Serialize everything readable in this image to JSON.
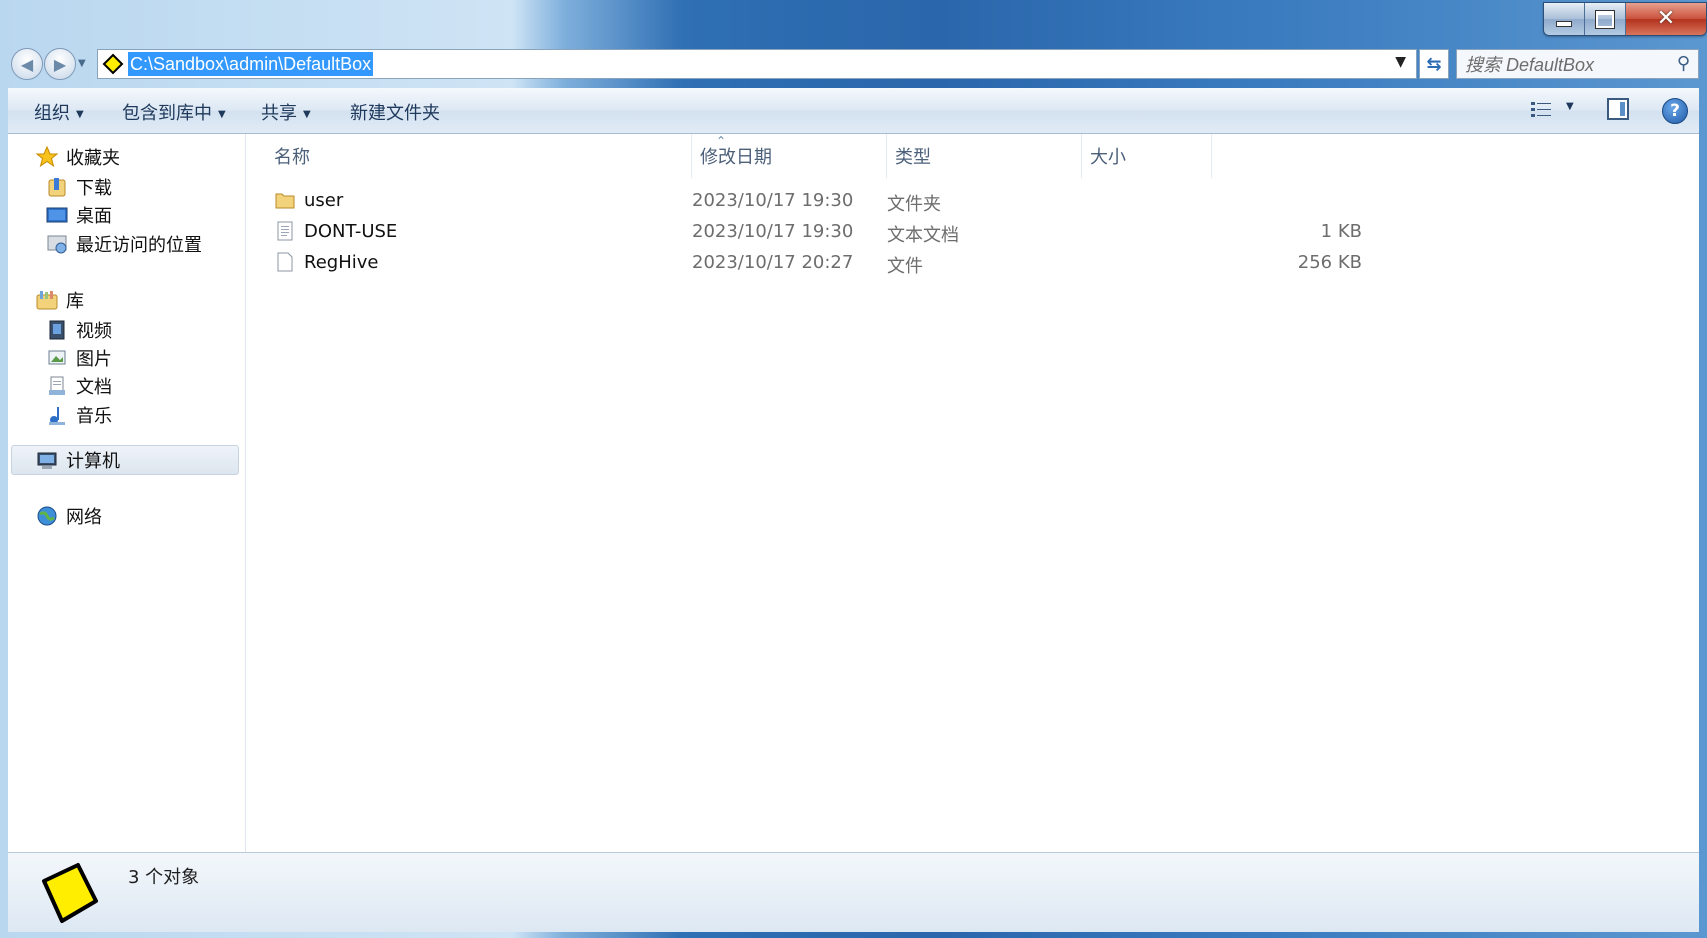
{
  "window": {
    "caption": {
      "minimize": "minimize-icon",
      "maximize": "maximize-icon",
      "close": "close-icon"
    }
  },
  "address_bar": {
    "path": "C:\\Sandbox\\admin\\DefaultBox",
    "selected_color": "#3399ff"
  },
  "search": {
    "placeholder": "搜索 DefaultBox"
  },
  "toolbar": {
    "organize": "组织",
    "include_in_library": "包含到库中",
    "share": "共享",
    "new_folder": "新建文件夹"
  },
  "sidebar": {
    "favorites": {
      "label": "收藏夹",
      "items": [
        {
          "label": "下载",
          "icon": "downloads-folder-icon"
        },
        {
          "label": "桌面",
          "icon": "desktop-icon"
        },
        {
          "label": "最近访问的位置",
          "icon": "recent-places-icon"
        }
      ]
    },
    "libraries": {
      "label": "库",
      "items": [
        {
          "label": "视频",
          "icon": "videos-icon"
        },
        {
          "label": "图片",
          "icon": "pictures-icon"
        },
        {
          "label": "文档",
          "icon": "documents-icon"
        },
        {
          "label": "音乐",
          "icon": "music-icon"
        }
      ]
    },
    "computer": {
      "label": "计算机",
      "icon": "computer-icon"
    },
    "network": {
      "label": "网络",
      "icon": "network-icon"
    }
  },
  "columns": {
    "name": "名称",
    "modified": "修改日期",
    "type": "类型",
    "size": "大小"
  },
  "files": [
    {
      "name": "user",
      "modified": "2023/10/17 19:30",
      "type": "文件夹",
      "size": "",
      "icon": "folder-icon"
    },
    {
      "name": "DONT-USE",
      "modified": "2023/10/17 19:30",
      "type": "文本文档",
      "size": "1 KB",
      "icon": "text-file-icon"
    },
    {
      "name": "RegHive",
      "modified": "2023/10/17 20:27",
      "type": "文件",
      "size": "256 KB",
      "icon": "file-icon"
    }
  ],
  "status": {
    "count_text": "3 个对象"
  },
  "colors": {
    "selection": "#3399ff",
    "sandbox_yellow": "#ffee00"
  }
}
